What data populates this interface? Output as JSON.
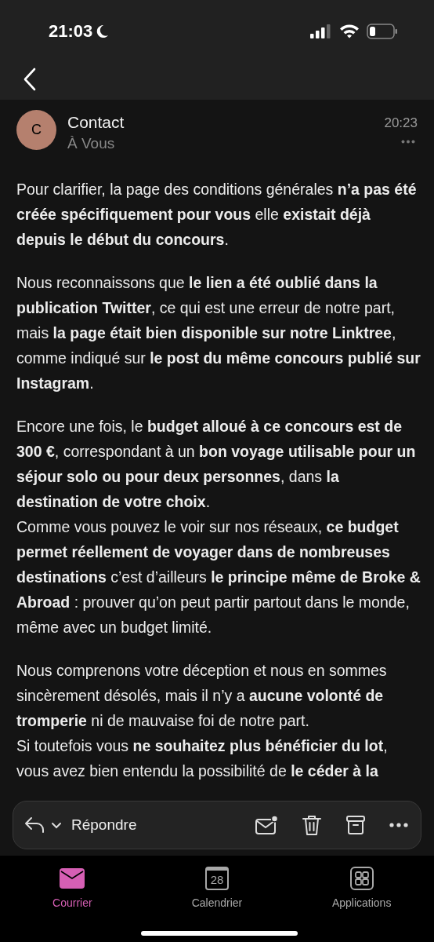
{
  "status_bar": {
    "time": "21:03"
  },
  "message": {
    "avatar_letter": "C",
    "sender": "Contact",
    "recipient": "À Vous",
    "time": "20:23",
    "paragraphs": [
      [
        "Pour clarifier, la page des conditions générales **n’a pas été créée spécifiquement pour vous** elle **existait déjà depuis le début du concours**."
      ],
      [
        "Nous reconnaissons que **le lien a été oublié dans la publication Twitter**, ce qui est une erreur de notre part, mais **la page était bien disponible sur notre Linktree**, comme indiqué sur **le post du même concours publié sur Instagram**."
      ],
      [
        "Encore une fois, le **budget alloué à ce concours est de 300 €**, correspondant à un **bon voyage utilisable pour un séjour solo ou pour deux personnes**, dans **la destination de votre choix**.",
        "Comme vous pouvez le voir sur nos réseaux, **ce budget permet réellement de voyager dans de nombreuses destinations** c’est d’ailleurs **le principe même de Broke & Abroad** : prouver qu’on peut partir partout dans le monde, même avec un budget limité."
      ],
      [
        "Nous comprenons votre déception et nous en sommes sincèrement désolés, mais il n’y a **aucune volonté de tromperie** ni de mauvaise foi de notre part.",
        "Si toutefois vous **ne souhaitez plus bénéficier du lot**, vous avez bien entendu la possibilité de **le céder à la**"
      ]
    ]
  },
  "toolbar": {
    "reply_label": "Répondre"
  },
  "tabs": [
    {
      "label": "Courrier",
      "kind": "mail",
      "selected": true
    },
    {
      "label": "Calendrier",
      "kind": "calendar",
      "icon_text": "28",
      "selected": false
    },
    {
      "label": "Applications",
      "kind": "apps",
      "selected": false
    }
  ]
}
